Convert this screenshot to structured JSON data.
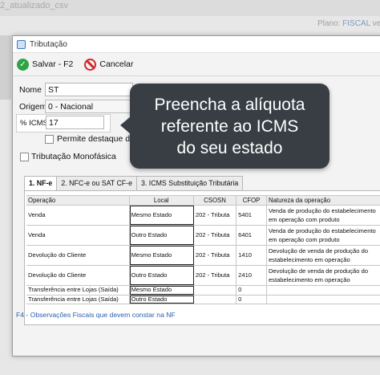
{
  "background": {
    "title": "2_atualizado_csv",
    "plano_label": "Plano:",
    "plano_value": "FISCAL",
    "plano_suffix": "vencim"
  },
  "dialog": {
    "title": "Tributação",
    "toolbar": {
      "save_label": "Salvar - F2",
      "cancel_label": "Cancelar"
    },
    "form": {
      "nome_label": "Nome",
      "nome_value": "ST",
      "origem_label": "Origem",
      "origem_value": "0 - Nacional",
      "icms_label": "% ICMS",
      "icms_value": "17",
      "destaque_label": "Permite destaque de ap",
      "monofasica_label": "Tributação Monofásica"
    },
    "tabs": [
      {
        "label": "1. NF-e",
        "active": true
      },
      {
        "label": "2. NFC-e  ou  SAT CF-e",
        "active": false
      },
      {
        "label": "3. ICMS Substituição Tributária",
        "active": false
      }
    ],
    "grid": {
      "columns": [
        "Operação",
        "Local",
        "CSOSN",
        "CFOP",
        "Natureza da operação"
      ],
      "rows": [
        {
          "operacao": "Venda",
          "local": "Mesmo Estado",
          "csosn": "202 - Tributa",
          "cfop": "5401",
          "natureza": "Venda de produção do estabelecimento em operação com produto"
        },
        {
          "operacao": "Venda",
          "local": "Outro Estado",
          "csosn": "202 - Tributa",
          "cfop": "6401",
          "natureza": "Venda de produção do estabelecimento em operação com produto"
        },
        {
          "operacao": "Devolução do Cliente",
          "local": "Mesmo Estado",
          "csosn": "202 - Tributa",
          "cfop": "1410",
          "natureza": "Devolução de venda de produção do estabelecimento em operação"
        },
        {
          "operacao": "Devolução do Cliente",
          "local": "Outro Estado",
          "csosn": "202 - Tributa",
          "cfop": "2410",
          "natureza": "Devolução de venda de produção do estabelecimento em operação"
        },
        {
          "operacao": "Transferência entre Lojas (Saída)",
          "local": "Mesmo Estado",
          "csosn": "",
          "cfop": "0",
          "natureza": ""
        },
        {
          "operacao": "Transferência entre Lojas (Saída)",
          "local": "Outro Estado",
          "csosn": "",
          "cfop": "0",
          "natureza": ""
        }
      ]
    },
    "footer_note": "F4 - Observações Fiscais que devem constar na NF"
  },
  "callout": {
    "line1": "Preencha a alíquota",
    "line2": "referente ao ICMS",
    "line3": "do seu estado"
  },
  "colors": {
    "accent": "#2a5faf",
    "callout_bg": "#383e44",
    "save_green": "#2fa446",
    "cancel_red": "#d3262b"
  },
  "icons": {
    "save": "check-circle-icon",
    "cancel": "prohibited-icon",
    "app": "window-icon"
  }
}
